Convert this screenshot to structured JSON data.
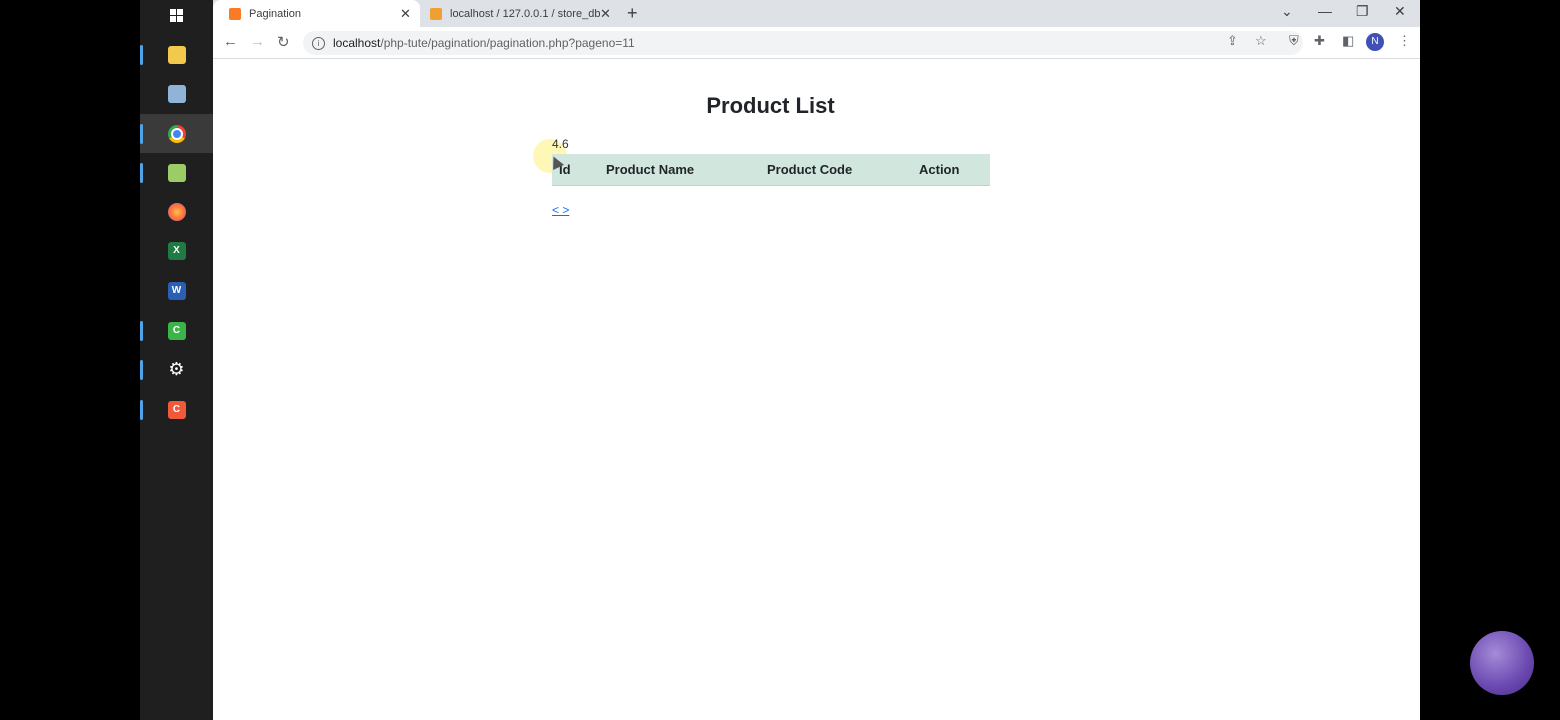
{
  "taskbar": {
    "items": [
      "windows-start",
      "file-explorer",
      "app",
      "chrome",
      "notepad-plus-plus",
      "firefox",
      "excel",
      "word",
      "camtasia",
      "settings",
      "camtasia-recorder"
    ]
  },
  "browser": {
    "tabs": [
      {
        "title": "Pagination",
        "active": true
      },
      {
        "title": "localhost / 127.0.0.1 / store_db /",
        "active": false
      }
    ],
    "url_host": "localhost",
    "url_path": "/php-tute/pagination/pagination.php?pageno=11",
    "profile_initial": "N"
  },
  "page": {
    "title": "Product List",
    "value_label": "4.6",
    "table": {
      "headers": [
        "Id",
        "Product Name",
        "Product Code",
        "Action"
      ],
      "rows": []
    },
    "pager": "< >"
  },
  "colors": {
    "table_header_bg": "#d1e7dd",
    "link": "#0d6efd"
  }
}
